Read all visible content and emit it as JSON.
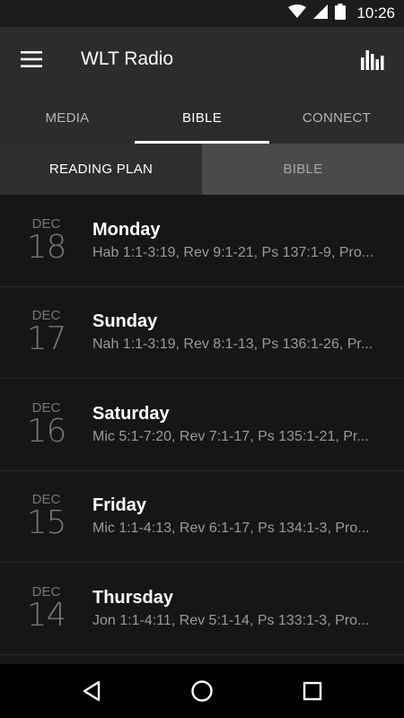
{
  "status_bar": {
    "time": "10:26",
    "icons": [
      "wifi-icon",
      "signal-icon",
      "battery-icon"
    ]
  },
  "app_bar": {
    "title": "WLT Radio",
    "left_icon": "menu-icon",
    "right_icon": "equalizer-icon"
  },
  "tabs": [
    {
      "label": "MEDIA",
      "active": false
    },
    {
      "label": "BIBLE",
      "active": true
    },
    {
      "label": "CONNECT",
      "active": false
    }
  ],
  "subtabs": [
    {
      "label": "READING PLAN",
      "active": true
    },
    {
      "label": "BIBLE",
      "active": false
    }
  ],
  "readings": [
    {
      "month": "DEC",
      "day": "18",
      "weekday": "Monday",
      "passages": "Hab 1:1-3:19, Rev 9:1-21, Ps 137:1-9, Pro..."
    },
    {
      "month": "DEC",
      "day": "17",
      "weekday": "Sunday",
      "passages": "Nah 1:1-3:19, Rev 8:1-13, Ps 136:1-26, Pr..."
    },
    {
      "month": "DEC",
      "day": "16",
      "weekday": "Saturday",
      "passages": "Mic 5:1-7:20, Rev 7:1-17, Ps 135:1-21, Pr..."
    },
    {
      "month": "DEC",
      "day": "15",
      "weekday": "Friday",
      "passages": "Mic 1:1-4:13, Rev 6:1-17, Ps 134:1-3, Pro..."
    },
    {
      "month": "DEC",
      "day": "14",
      "weekday": "Thursday",
      "passages": "Jon 1:1-4:11, Rev 5:1-14, Ps 133:1-3, Pro..."
    }
  ],
  "nav_bar": {
    "icons": [
      "back-icon",
      "home-icon",
      "recents-icon"
    ]
  }
}
